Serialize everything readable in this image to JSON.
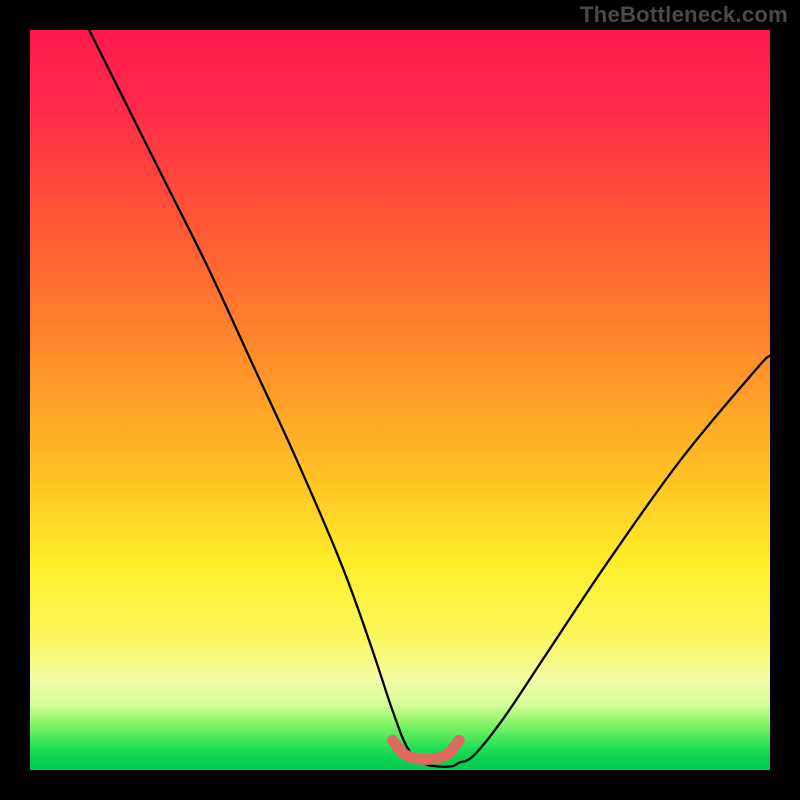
{
  "watermark": "TheBottleneck.com",
  "chart_data": {
    "type": "line",
    "title": "",
    "xlabel": "",
    "ylabel": "",
    "xlim": [
      0,
      100
    ],
    "ylim": [
      0,
      100
    ],
    "grid": false,
    "series": [
      {
        "name": "bottleneck-curve",
        "x": [
          8,
          12,
          18,
          24,
          30,
          36,
          42,
          46,
          49,
          51,
          53,
          55,
          57,
          58,
          60,
          64,
          70,
          78,
          88,
          98,
          100
        ],
        "values": [
          100,
          92,
          80,
          68,
          55,
          42,
          28,
          17,
          8,
          3,
          1,
          0.5,
          0.5,
          1,
          2,
          7,
          16,
          28,
          42,
          54,
          56
        ]
      }
    ],
    "annotations": [
      {
        "name": "optimal-band",
        "x": [
          49,
          50.5,
          52,
          53.5,
          55,
          56.5,
          58
        ],
        "values": [
          4,
          2.2,
          1.6,
          1.4,
          1.6,
          2.2,
          4
        ]
      }
    ],
    "background_gradient": {
      "orientation": "vertical",
      "stops": [
        {
          "pos": 0.0,
          "color": "#ff1a4d"
        },
        {
          "pos": 0.5,
          "color": "#ffa028"
        },
        {
          "pos": 0.8,
          "color": "#fff04a"
        },
        {
          "pos": 0.93,
          "color": "#8ef56a"
        },
        {
          "pos": 1.0,
          "color": "#04cb4e"
        }
      ]
    }
  }
}
